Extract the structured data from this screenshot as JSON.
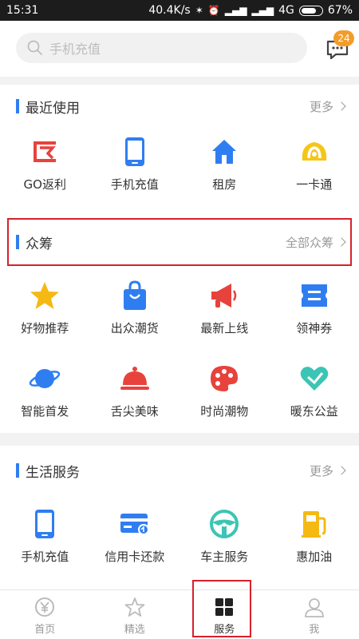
{
  "status_bar": {
    "time": "15:31",
    "speed": "40.4K/s",
    "network": "4G",
    "battery": "67%",
    "battery_level": 0.67
  },
  "search": {
    "placeholder": "手机充值"
  },
  "messages": {
    "badge_count": "24"
  },
  "recent": {
    "title": "最近使用",
    "more": "更多",
    "items": [
      {
        "label": "GO返利",
        "icon": "fanli-icon"
      },
      {
        "label": "手机充值",
        "icon": "phone-icon"
      },
      {
        "label": "租房",
        "icon": "house-icon"
      },
      {
        "label": "一卡通",
        "icon": "card-icon"
      }
    ]
  },
  "crowdfunding": {
    "title": "众筹",
    "more": "全部众筹",
    "items": [
      {
        "label": "好物推荐",
        "icon": "star-icon"
      },
      {
        "label": "出众潮货",
        "icon": "shopping-bag-icon"
      },
      {
        "label": "最新上线",
        "icon": "megaphone-icon"
      },
      {
        "label": "领神券",
        "icon": "coupon-icon"
      },
      {
        "label": "智能首发",
        "icon": "planet-icon"
      },
      {
        "label": "舌尖美味",
        "icon": "cloche-icon"
      },
      {
        "label": "时尚潮物",
        "icon": "palette-icon"
      },
      {
        "label": "暖东公益",
        "icon": "heart-icon"
      }
    ]
  },
  "life_services": {
    "title": "生活服务",
    "more": "更多",
    "items": [
      {
        "label": "手机充值",
        "icon": "phone-icon"
      },
      {
        "label": "信用卡还款",
        "icon": "credit-card-icon"
      },
      {
        "label": "车主服务",
        "icon": "steering-wheel-icon"
      },
      {
        "label": "惠加油",
        "icon": "fuel-pump-icon"
      }
    ]
  },
  "tabs": [
    {
      "label": "首页",
      "icon": "home-yen-icon"
    },
    {
      "label": "精选",
      "icon": "star-outline-icon"
    },
    {
      "label": "服务",
      "icon": "grid-icon"
    },
    {
      "label": "我",
      "icon": "user-icon"
    }
  ],
  "colors": {
    "accent": "#2f7ef1",
    "highlight": "#d8202b",
    "badge": "#f39c2b"
  }
}
